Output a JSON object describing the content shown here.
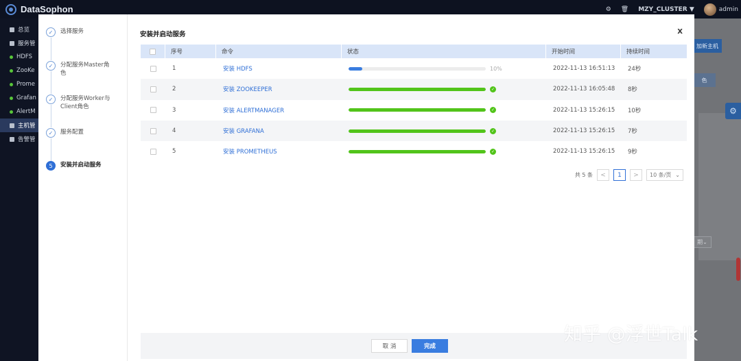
{
  "topbar": {
    "app_name": "DataSophon",
    "cluster_name": "MZY_CLUSTER",
    "user_name": "admin",
    "icons": [
      "settings-icon",
      "notification-icon",
      "chevron-down-icon"
    ]
  },
  "sidebar": {
    "items": [
      {
        "label": "总览",
        "type": "icon"
      },
      {
        "label": "服务管",
        "type": "icon"
      },
      {
        "label": "HDFS",
        "type": "service"
      },
      {
        "label": "ZooKe",
        "type": "service"
      },
      {
        "label": "Prome",
        "type": "service"
      },
      {
        "label": "Grafan",
        "type": "service"
      },
      {
        "label": "AlertM",
        "type": "service"
      },
      {
        "label": "主机管",
        "type": "icon",
        "active": true
      },
      {
        "label": "告警管",
        "type": "icon"
      }
    ]
  },
  "background": {
    "button_label": "加新主机",
    "button2_label": "色",
    "select_label": "期"
  },
  "steps": [
    {
      "index": "✓",
      "label": "选择服务",
      "current": false
    },
    {
      "index": "✓",
      "label": "分配服务Master角色",
      "current": false
    },
    {
      "index": "✓",
      "label": "分配服务Worker与Client角色",
      "current": false
    },
    {
      "index": "✓",
      "label": "服务配置",
      "current": false
    },
    {
      "index": "5",
      "label": "安装并启动服务",
      "current": true
    }
  ],
  "dialog": {
    "title": "安装并启动服务",
    "close_label": "X"
  },
  "table": {
    "headers": [
      "序号",
      "命令",
      "状态",
      "开始时间",
      "持续时间"
    ],
    "rows": [
      {
        "idx": "1",
        "command": "安装 HDFS",
        "progress": 0.1,
        "pct_label": "10%",
        "done": false,
        "start": "2022-11-13 16:51:13",
        "duration": "24秒"
      },
      {
        "idx": "2",
        "command": "安装 ZOOKEEPER",
        "progress": 1.0,
        "pct_label": "",
        "done": true,
        "start": "2022-11-13 16:05:48",
        "duration": "8秒"
      },
      {
        "idx": "3",
        "command": "安装 ALERTMANAGER",
        "progress": 1.0,
        "pct_label": "",
        "done": true,
        "start": "2022-11-13 15:26:15",
        "duration": "10秒"
      },
      {
        "idx": "4",
        "command": "安装 GRAFANA",
        "progress": 1.0,
        "pct_label": "",
        "done": true,
        "start": "2022-11-13 15:26:15",
        "duration": "7秒"
      },
      {
        "idx": "5",
        "command": "安装 PROMETHEUS",
        "progress": 1.0,
        "pct_label": "",
        "done": true,
        "start": "2022-11-13 15:26:15",
        "duration": "9秒"
      }
    ],
    "colors": {
      "running": "#3a7de0",
      "done": "#52c41a"
    }
  },
  "pagination": {
    "total_label": "共 5 条",
    "prev": "<",
    "current_page": "1",
    "next": ">",
    "page_size": "10 条/页"
  },
  "footer": {
    "cancel_label": "取 消",
    "done_label": "完成"
  },
  "watermark": "知乎 @浮世Talk"
}
